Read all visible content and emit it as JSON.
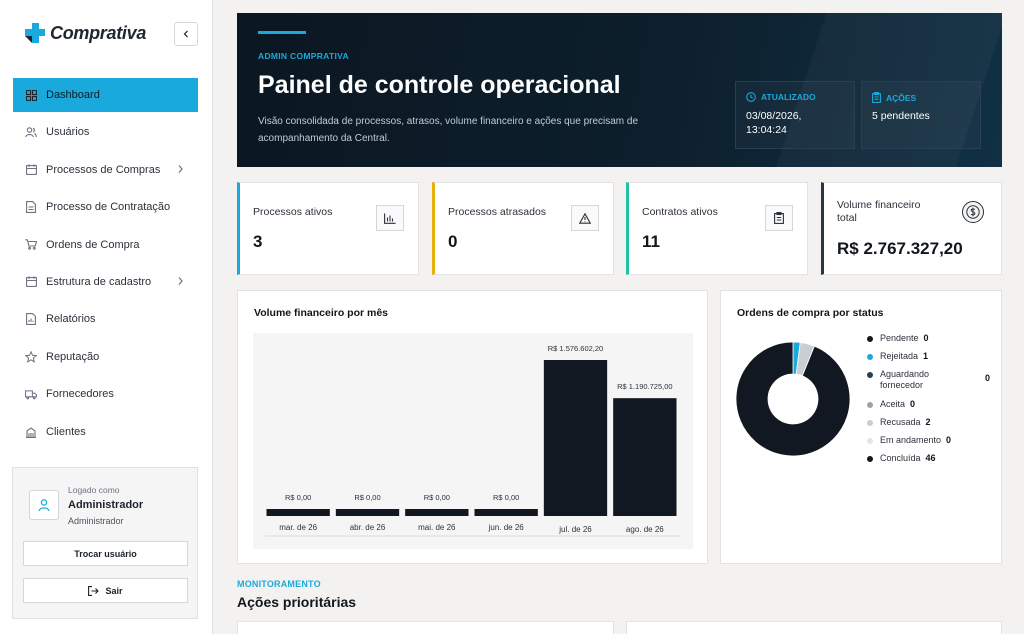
{
  "brand": {
    "name": "Comprativa",
    "logo_color": "#1aa9dc"
  },
  "sidebar": {
    "collapse_icon": "chevron-left-icon",
    "items": [
      {
        "label": "Dashboard",
        "icon": "grid-icon",
        "active": true
      },
      {
        "label": "Usuários",
        "icon": "users-icon"
      },
      {
        "label": "Processos de Compras",
        "icon": "calendar-icon",
        "submenu": true
      },
      {
        "label": "Processo de Contratação",
        "icon": "file-icon"
      },
      {
        "label": "Ordens de Compra",
        "icon": "cart-icon"
      },
      {
        "label": "Estrutura de cadastro",
        "icon": "calendar-icon",
        "submenu": true
      },
      {
        "label": "Relatórios",
        "icon": "report-icon"
      },
      {
        "label": "Reputação",
        "icon": "star-icon"
      },
      {
        "label": "Fornecedores",
        "icon": "truck-icon"
      },
      {
        "label": "Clientes",
        "icon": "building-icon"
      }
    ]
  },
  "user": {
    "logged_as": "Logado como",
    "name": "Administrador",
    "role": "Administrador",
    "switch_label": "Trocar usuário",
    "logout_label": "Sair"
  },
  "hero": {
    "eyebrow": "ADMIN COMPRATIVA",
    "title": "Painel de controle operacional",
    "subtitle": "Visão consolidada de processos, atrasos, volume financeiro e ações que precisam de acompanhamento da Central.",
    "updated_label": "ATUALIZADO",
    "updated_value": "03/08/2026, 13:04:24",
    "actions_label": "AÇÕES",
    "actions_value": "5 pendentes"
  },
  "stats": [
    {
      "label": "Processos ativos",
      "value": "3",
      "icon": "bar-chart-icon",
      "color": "#1aa9dc"
    },
    {
      "label": "Processos atrasados",
      "value": "0",
      "icon": "warning-icon",
      "color": "#e8b00f"
    },
    {
      "label": "Contratos ativos",
      "value": "11",
      "icon": "clipboard-icon",
      "color": "#22c3a5"
    },
    {
      "label": "Volume financeiro total",
      "value": "R$ 2.767.327,20",
      "icon": "dollar-icon",
      "color": "#2a3645"
    }
  ],
  "bar_panel": {
    "title": "Volume financeiro por mês"
  },
  "pie_panel": {
    "title": "Ordens de compra por status"
  },
  "chart_data": [
    {
      "type": "bar",
      "title": "Volume financeiro por mês",
      "categories": [
        "mar. de 26",
        "abr. de 26",
        "mai. de 26",
        "jun. de 26",
        "jul. de 26",
        "ago. de 26"
      ],
      "values": [
        0,
        0,
        0,
        0,
        1576602.2,
        1190725.0
      ],
      "value_labels": [
        "R$ 0,00",
        "R$ 0,00",
        "R$ 0,00",
        "R$ 0,00",
        "R$ 1.576.602,20",
        "R$ 1.190.725,00"
      ],
      "color": "#111821",
      "grid": false
    },
    {
      "type": "pie",
      "donut": true,
      "title": "Ordens de compra por status",
      "legend_position": "right",
      "labels": [
        "Pendente",
        "Rejeitada",
        "Aguardando fornecedor",
        "Aceita",
        "Recusada",
        "Em andamento",
        "Concluída"
      ],
      "values": [
        0,
        1,
        0,
        0,
        2,
        0,
        46
      ],
      "colors": [
        "#111821",
        "#1aa9dc",
        "#2a3b52",
        "#9aa3ab",
        "#c9ced3",
        "#e2e4e6",
        "#111821"
      ]
    }
  ],
  "monitor": {
    "eyebrow": "MONITORAMENTO",
    "title": "Ações prioritárias"
  }
}
